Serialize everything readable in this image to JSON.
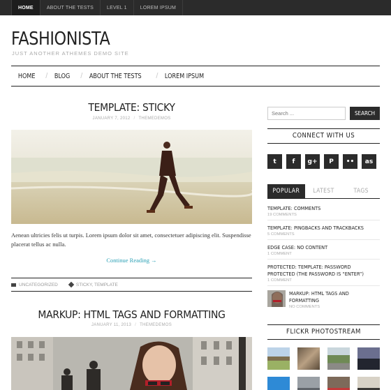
{
  "topbar": {
    "items": [
      "HOME",
      "ABOUT THE TESTS",
      "LEVEL 1",
      "LOREM IPSUM"
    ]
  },
  "site": {
    "title": "FASHIONISTA",
    "description": "JUST ANOTHER ATHEMES DEMO SITE"
  },
  "nav": {
    "items": [
      "HOME",
      "BLOG",
      "ABOUT THE TESTS",
      "LOREM IPSUM"
    ]
  },
  "posts": [
    {
      "title": "TEMPLATE: STICKY",
      "date": "JANUARY 7, 2012",
      "author": "THEMEDEMOS",
      "excerpt": "Aenean ultricies felis ut turpis. Lorem ipsum dolor sit amet, consectetuer adipiscing elit. Suspendisse placerat tellus ac nulla.",
      "continue": "Continue Reading →",
      "category": "UNCATEGORIZED",
      "tags": "STICKY, TEMPLATE"
    },
    {
      "title": "MARKUP: HTML TAGS AND FORMATTING",
      "date": "JANUARY 11, 2013",
      "author": "THEMEDEMOS"
    }
  ],
  "sidebar": {
    "search_placeholder": "Search ...",
    "search_button": "SEARCH",
    "connect_title": "CONNECT WITH US",
    "social": [
      {
        "icon": "twitter-icon",
        "glyph": "t"
      },
      {
        "icon": "facebook-icon",
        "glyph": "f"
      },
      {
        "icon": "googleplus-icon",
        "glyph": "g+"
      },
      {
        "icon": "pinterest-icon",
        "glyph": "P"
      },
      {
        "icon": "flickr-icon",
        "glyph": "••"
      },
      {
        "icon": "lastfm-icon",
        "glyph": "as"
      }
    ],
    "tabs": [
      "POPULAR",
      "LATEST",
      "TAGS"
    ],
    "popular": [
      {
        "title": "TEMPLATE: COMMENTS",
        "comments": "19 COMMENTS"
      },
      {
        "title": "TEMPLATE: PINGBACKS AND TRACKBACKS",
        "comments": "5 COMMENTS"
      },
      {
        "title": "EDGE CASE: NO CONTENT",
        "comments": "1 COMMENT"
      },
      {
        "title": "PROTECTED: TEMPLATE: PASSWORD PROTECTED (THE PASSWORD IS “ENTER”)",
        "comments": "1 COMMENT"
      },
      {
        "title": "MARKUP: HTML TAGS AND FORMATTING",
        "comments": "NO COMMENTS"
      }
    ],
    "flickr_title": "FLICKR PHOTOSTREAM"
  },
  "colors": {
    "dark": "#2b2b2b",
    "link": "#2aa0b5"
  }
}
